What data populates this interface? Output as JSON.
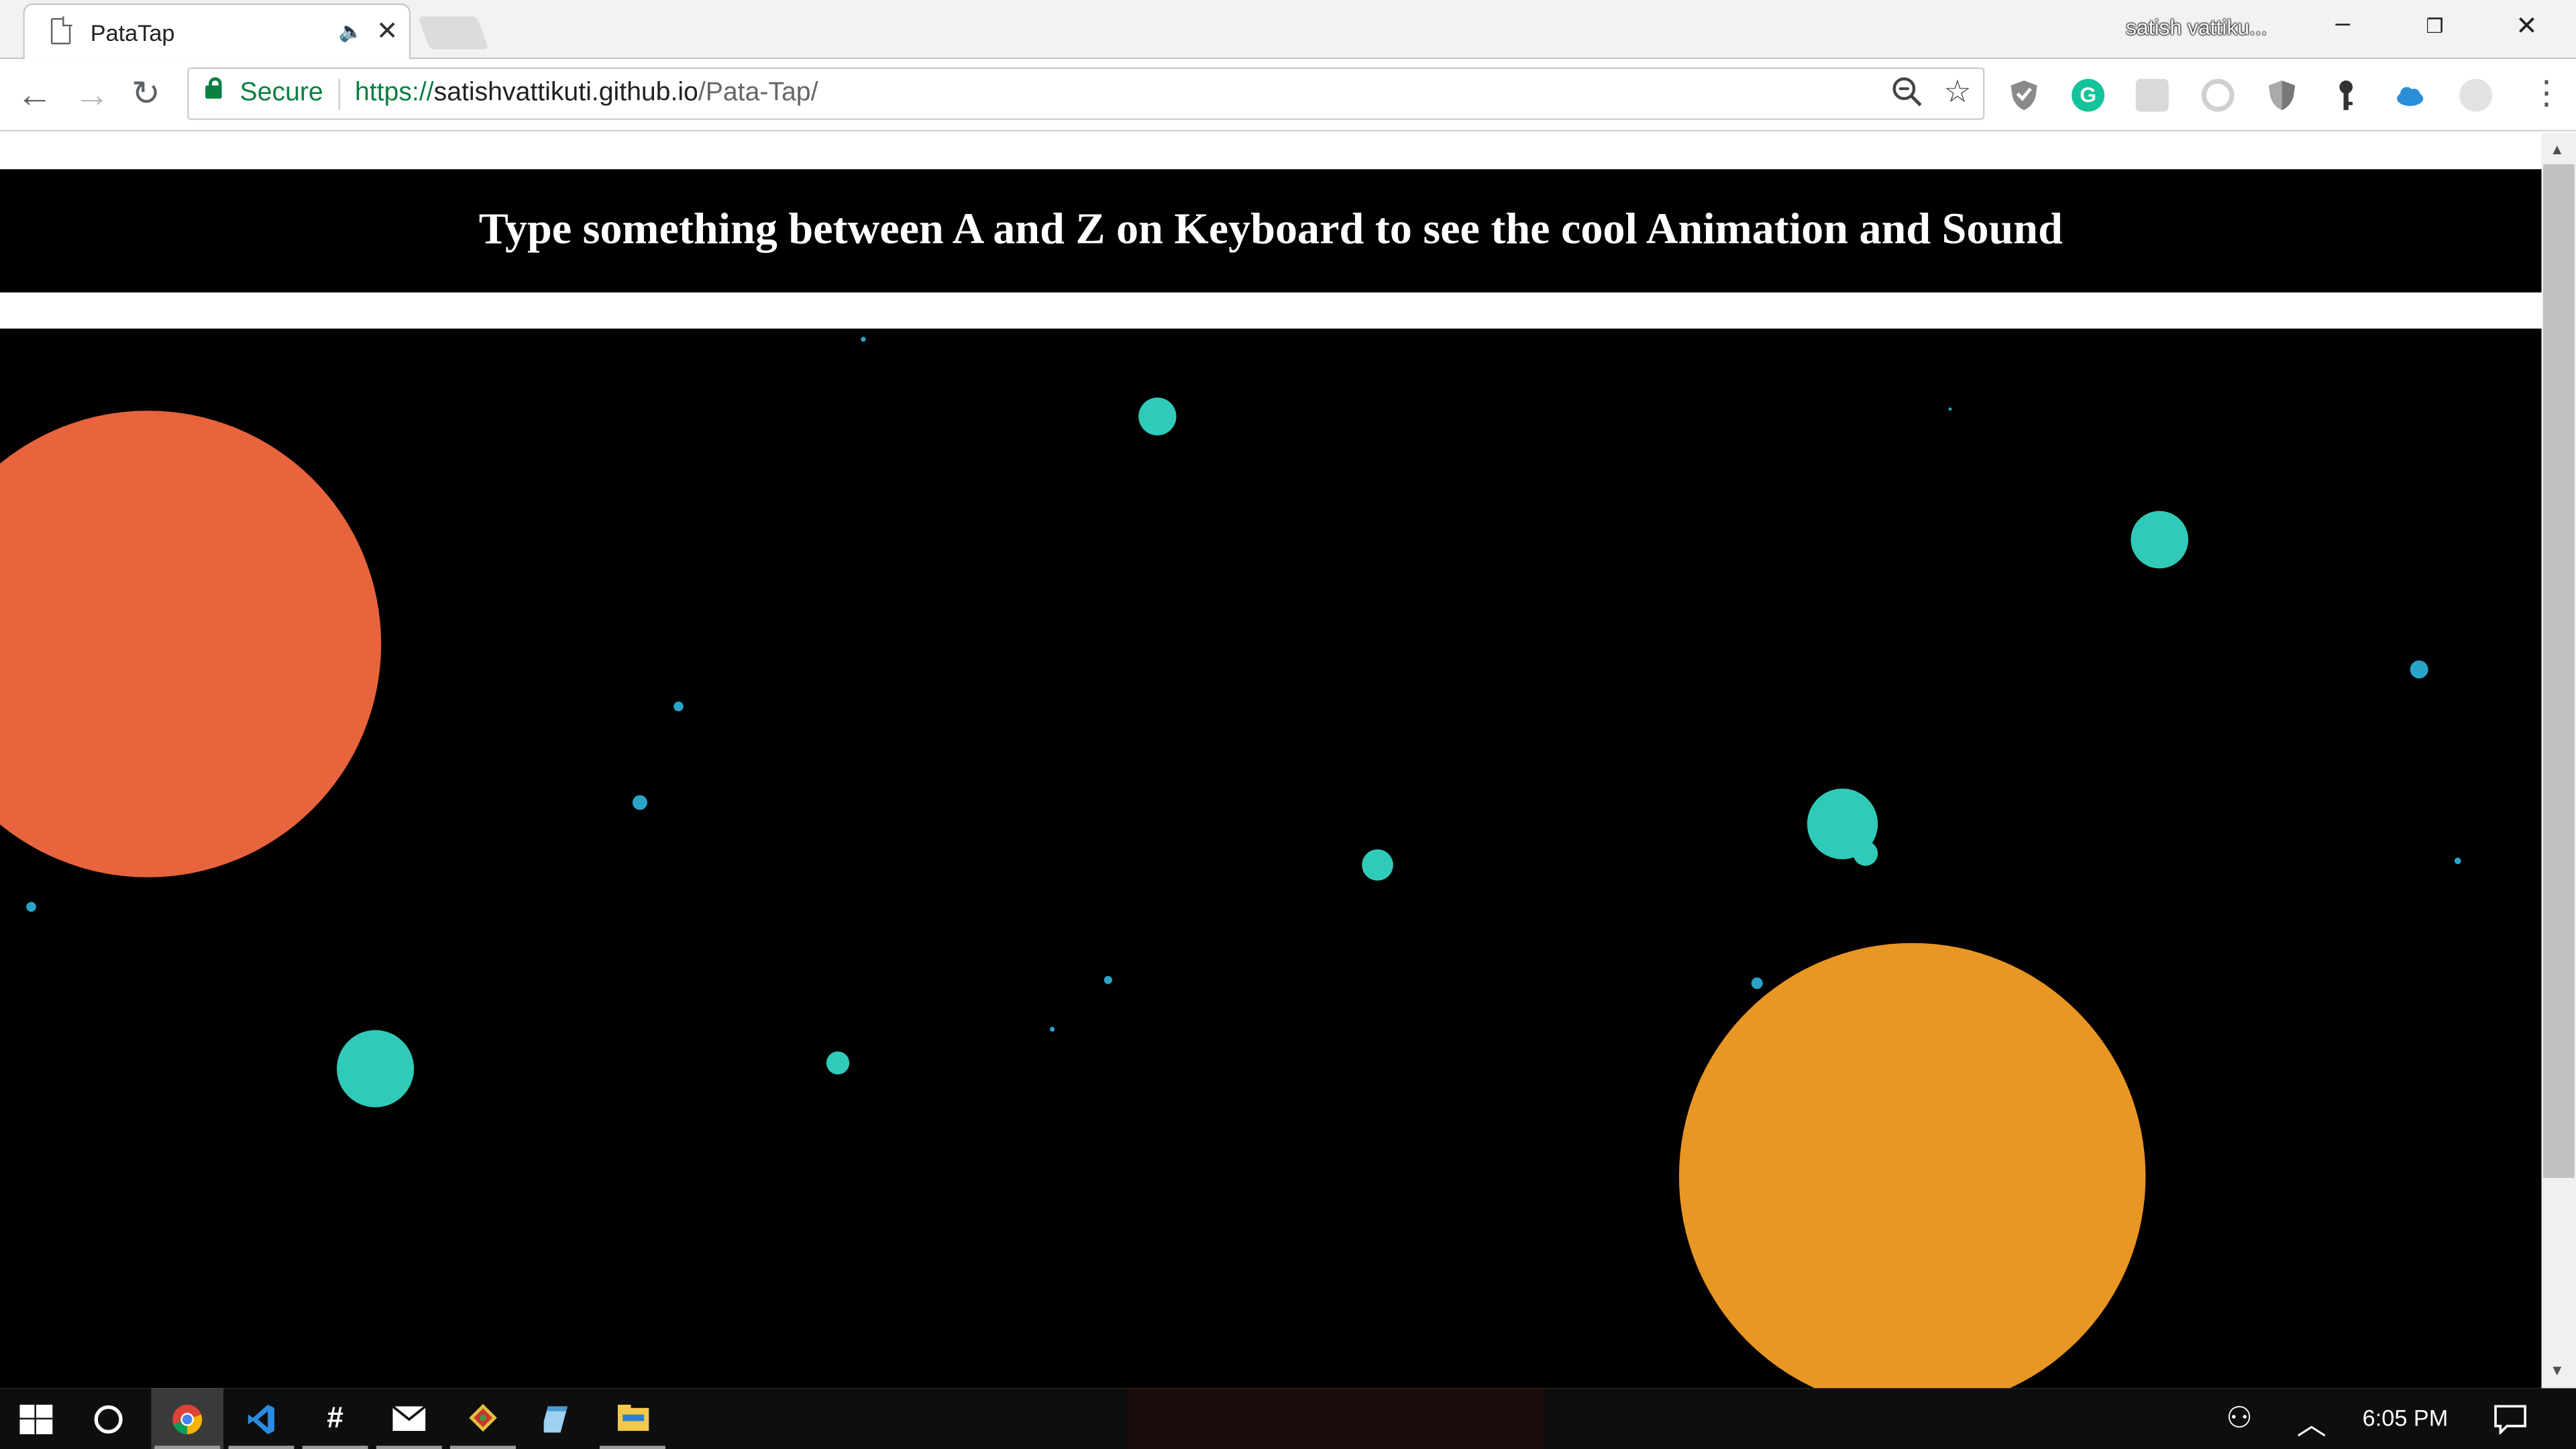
{
  "browser": {
    "tab_title": "PataTap",
    "profile_name": "satish vattiku...",
    "window_controls": {
      "minimize": "–",
      "restore": "❐",
      "close": "✕"
    },
    "omnibox": {
      "security_label": "Secure",
      "url_scheme": "https://",
      "url_host": "satishvattikuti.github.io",
      "url_path": "/Pata-Tap/"
    },
    "extensions": [
      "shield-ext-icon",
      "grammarly-icon",
      "puzzle-ext-icon",
      "circle-ext-icon",
      "shield-grey-icon",
      "key-icon",
      "cloud-icon",
      "swirl-ext-icon"
    ]
  },
  "page": {
    "banner_text": "Type something between A and Z on Keyboard to see the cool Animation and Sound",
    "colors": {
      "orange_red": "#e8643c",
      "orange": "#e89624",
      "teal": "#2fcbb8",
      "blue_dot": "#29a3c8",
      "background": "#000000"
    }
  },
  "taskbar": {
    "apps": [
      "windows-start-icon",
      "cortana-icon",
      "chrome-icon",
      "vscode-icon",
      "slack-icon",
      "mail-icon",
      "git-icon",
      "notepad-icon",
      "file-explorer-icon"
    ],
    "clock": "6:05 PM"
  }
}
